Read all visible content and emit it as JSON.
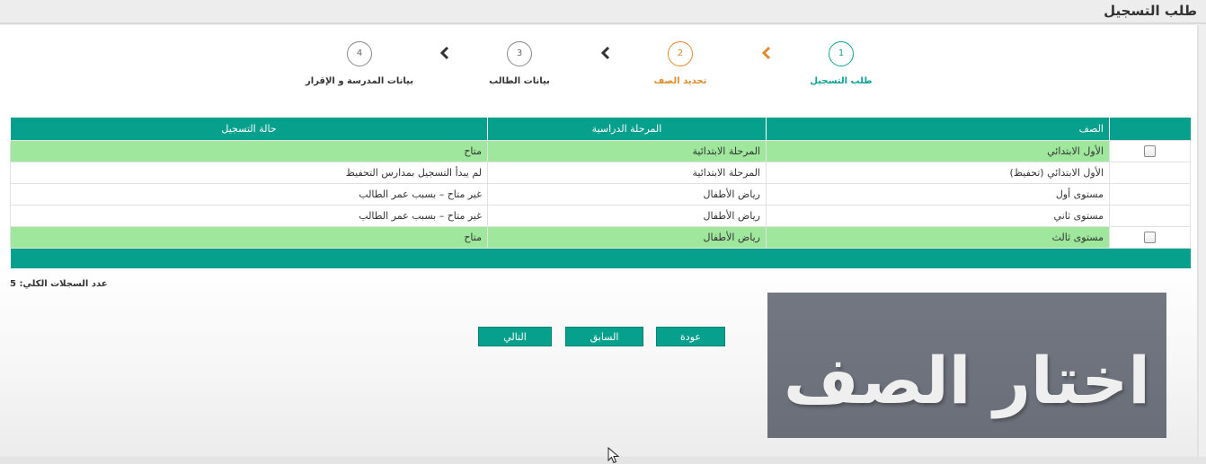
{
  "page": {
    "title": "طلب التسجيل"
  },
  "steps": [
    {
      "number": "1",
      "label": "طلب التسجيل",
      "state": "active"
    },
    {
      "number": "2",
      "label": "تحديد الصف",
      "state": "current"
    },
    {
      "number": "3",
      "label": "بيانات الطالب",
      "state": "pending"
    },
    {
      "number": "4",
      "label": "بيانات المدرسة و الإقرار",
      "state": "pending"
    }
  ],
  "table": {
    "columns": {
      "grade": "الصف",
      "stage": "المرحلة الدراسية",
      "status": "حالة التسجيل"
    },
    "rows": [
      {
        "grade": "الأول الابتدائي",
        "stage": "المرحلة الابتدائية",
        "status": "متاح",
        "selectable": true,
        "checked": false
      },
      {
        "grade": "الأول الابتدائي (تحفيظ)",
        "stage": "المرحلة الابتدائية",
        "status": "لم يبدأ التسجيل بمدارس التحفيظ",
        "selectable": false
      },
      {
        "grade": "مستوى أول",
        "stage": "رياض الأطفال",
        "status": "غير متاح – بسبب عمر الطالب",
        "selectable": false
      },
      {
        "grade": "مستوى ثاني",
        "stage": "رياض الأطفال",
        "status": "غير متاح – بسبب عمر الطالب",
        "selectable": false
      },
      {
        "grade": "مستوى ثالث",
        "stage": "رياض الأطفال",
        "status": "متاح",
        "selectable": true,
        "checked": false
      }
    ]
  },
  "record_count": "عدد السجلات الكلي: 5",
  "buttons": {
    "back": "عودة",
    "previous": "السابق",
    "next": "التالي"
  },
  "overlay": {
    "text": "اختار الصف"
  },
  "colors": {
    "primary": "#07a08c",
    "available_row": "#9ee79c",
    "current_step": "#e08a2c"
  }
}
